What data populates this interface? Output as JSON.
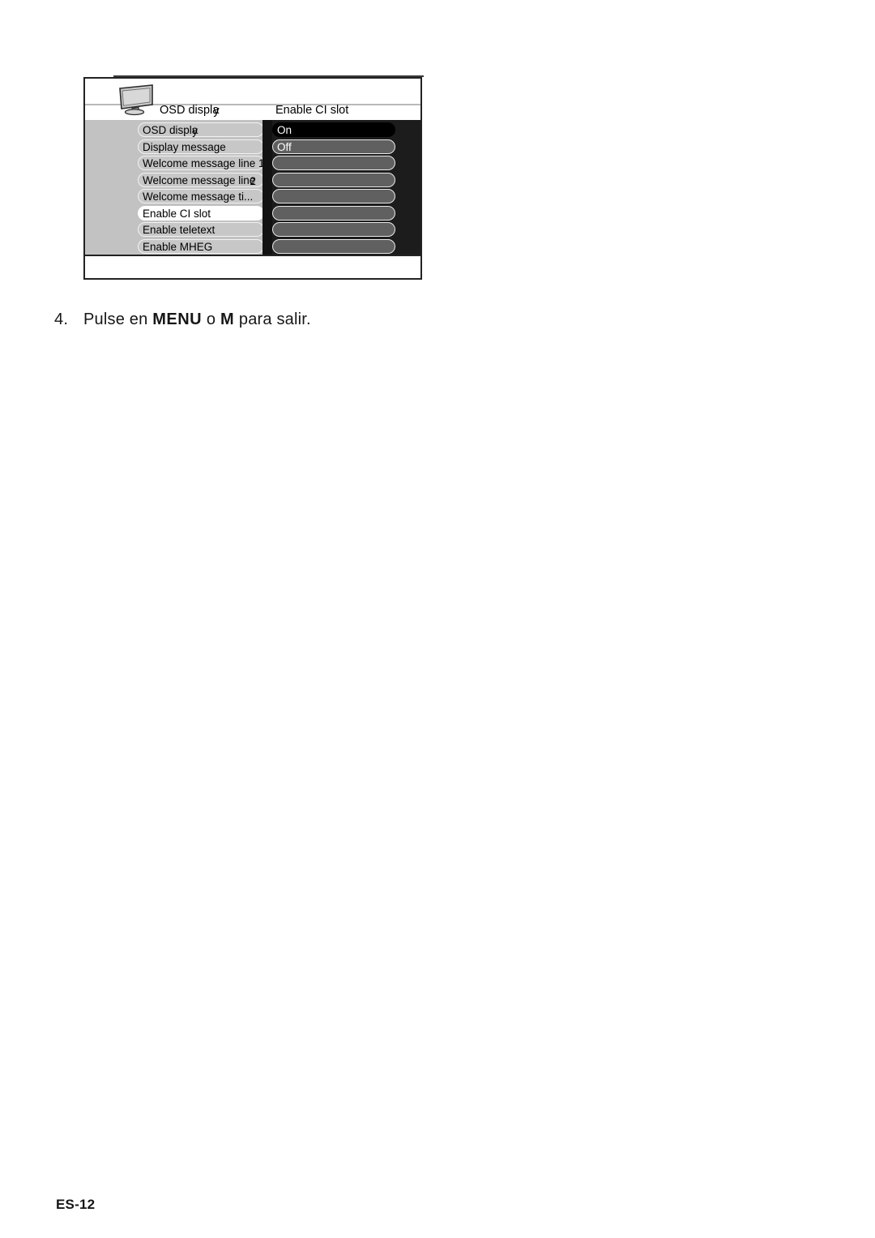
{
  "page": {
    "footer_label": "ES-12"
  },
  "instruction": {
    "number": "4.",
    "text_before": "Pulse en ",
    "key_primary": "MENU",
    "text_middle": " o ",
    "key_secondary": "M",
    "text_after": " para salir."
  },
  "osd": {
    "icon": "tv-monitor-icon",
    "header": {
      "left_title_main": "OSD displa",
      "left_title_overlap": "y",
      "right_title": "Enable CI slot"
    },
    "left_menu": {
      "items": [
        {
          "label_main": "OSD displa",
          "label_overlap": "y",
          "selected": false
        },
        {
          "label_main": "Display message",
          "label_overlap": "",
          "selected": false
        },
        {
          "label_main": "Welcome message line 1",
          "label_overlap": "",
          "selected": false
        },
        {
          "label_main": "Welcome message line",
          "label_overlap": "2",
          "selected": false
        },
        {
          "label_main": "Welcome message ti...",
          "label_overlap": "",
          "selected": false
        },
        {
          "label_main": "Enable CI slot",
          "label_overlap": "",
          "selected": true
        },
        {
          "label_main": "Enable teletext",
          "label_overlap": "",
          "selected": false
        },
        {
          "label_main": "Enable MHEG",
          "label_overlap": "",
          "selected": false
        }
      ]
    },
    "right_menu": {
      "items": [
        {
          "label": "On",
          "highlight": true
        },
        {
          "label": "Off",
          "highlight": false
        },
        {
          "label": "",
          "highlight": false
        },
        {
          "label": "",
          "highlight": false
        },
        {
          "label": "",
          "highlight": false
        },
        {
          "label": "",
          "highlight": false
        },
        {
          "label": "",
          "highlight": false
        },
        {
          "label": "",
          "highlight": false
        }
      ]
    },
    "colors": {
      "pane_light": "#c2c2c2",
      "pane_dark": "#1c1c1c",
      "pill_light": "#c7c7c7",
      "pill_dark": "#606060",
      "pill_selected": "#ffffff",
      "pill_highlight": "#000000"
    }
  }
}
